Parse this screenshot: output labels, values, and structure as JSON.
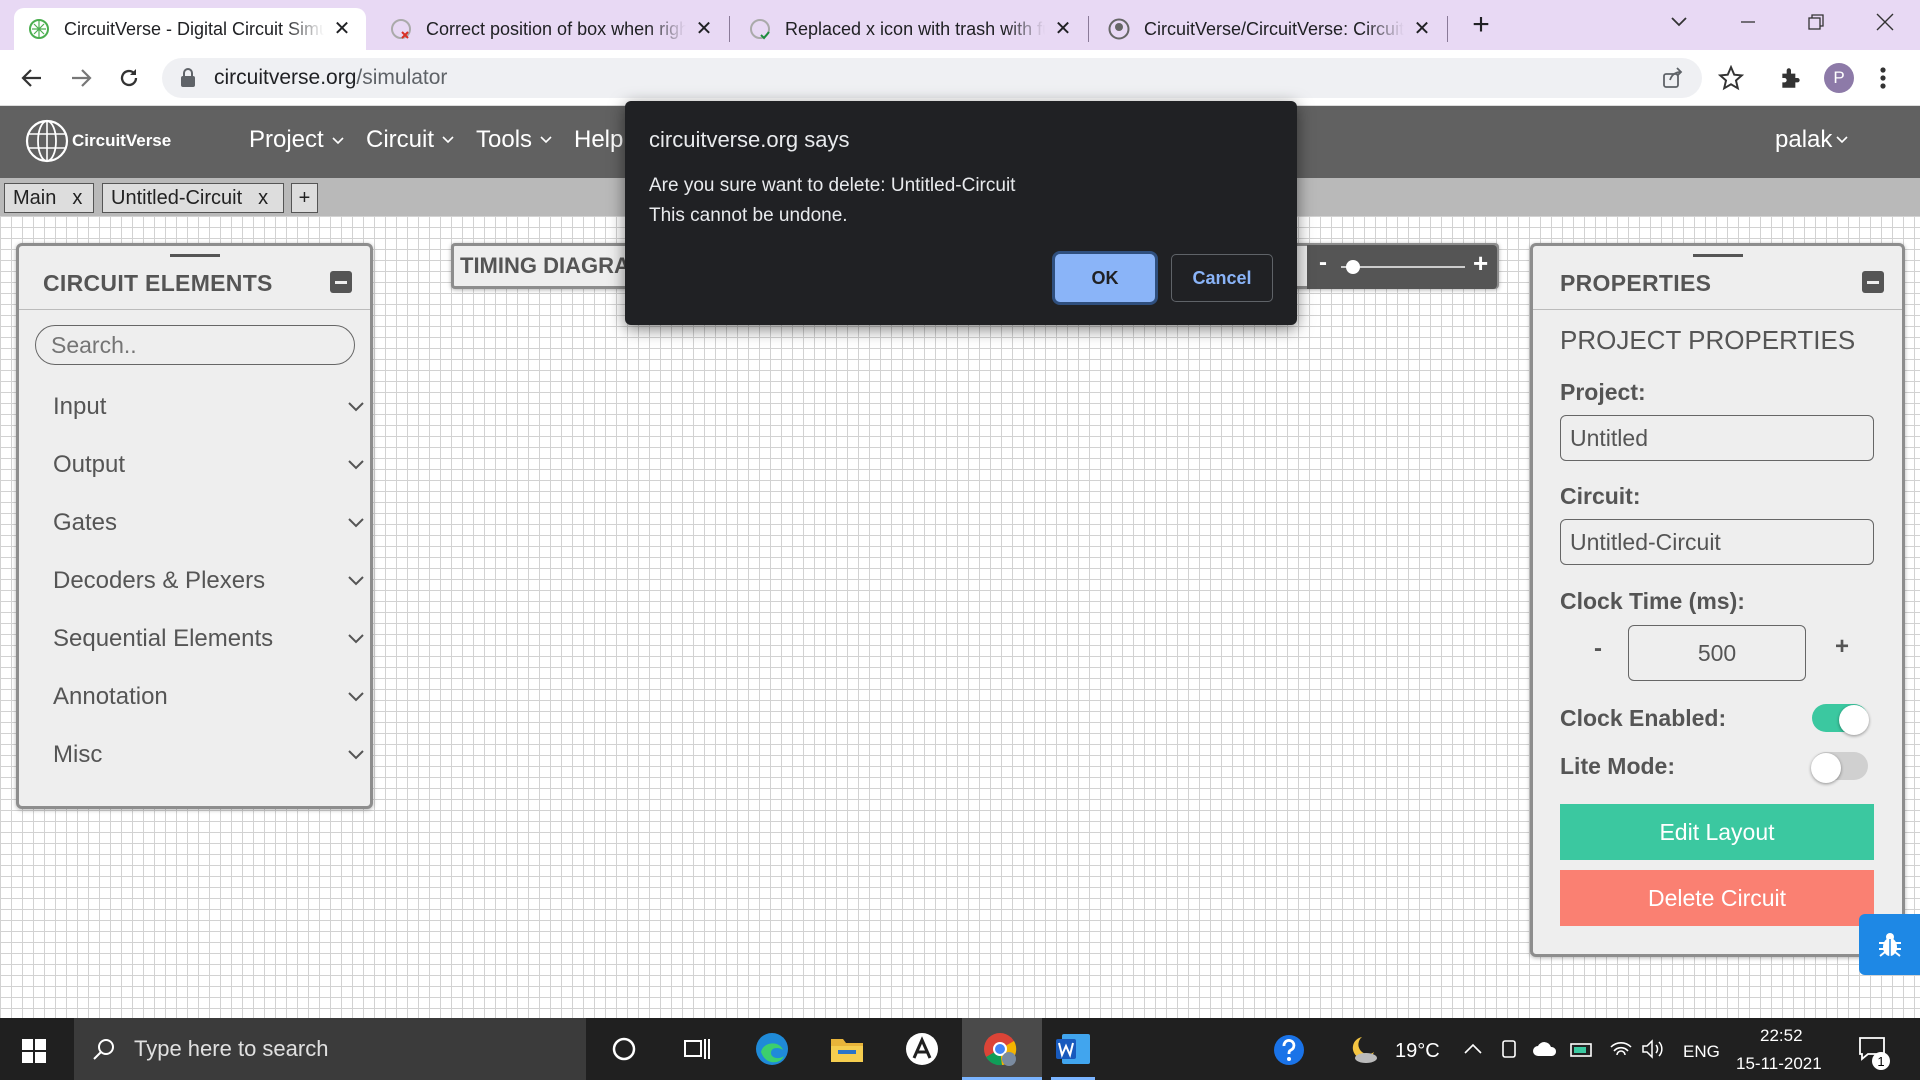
{
  "browser": {
    "tabs": [
      {
        "title": "CircuitVerse - Digital Circuit Simulator online",
        "active": true
      },
      {
        "title": "Correct position of box when right clicked"
      },
      {
        "title": "Replaced x icon with trash with functionality"
      },
      {
        "title": "CircuitVerse/CircuitVerse: CircuitVerse"
      }
    ],
    "close_glyph": "✕",
    "new_tab_glyph": "+",
    "url_host": "circuitverse.org",
    "url_path": "/simulator",
    "profile_initial": "P"
  },
  "nav": {
    "logo_text": "CircuitVerse",
    "menus": [
      "Project",
      "Circuit",
      "Tools",
      "Help"
    ],
    "user": "palak"
  },
  "circuit_tabs": [
    {
      "label": "Main",
      "close": "x"
    },
    {
      "label": "Untitled-Circuit",
      "close": "x"
    }
  ],
  "add_tab": "+",
  "timing": {
    "label": "TIMING DIAGRAM",
    "minus": "-",
    "plus": "+",
    "slider_level": 0.1
  },
  "elements_panel": {
    "title": "CIRCUIT ELEMENTS",
    "search_placeholder": "Search..",
    "groups": [
      "Input",
      "Output",
      "Gates",
      "Decoders & Plexers",
      "Sequential Elements",
      "Annotation",
      "Misc"
    ]
  },
  "properties": {
    "title": "PROPERTIES",
    "subtitle": "PROJECT PROPERTIES",
    "project_label": "Project:",
    "project_value": "Untitled",
    "circuit_label": "Circuit:",
    "circuit_value": "Untitled-Circuit",
    "clock_label": "Clock Time (ms):",
    "clock_value": "500",
    "clock_minus": "-",
    "clock_plus": "+",
    "clock_enabled_label": "Clock Enabled:",
    "clock_enabled": true,
    "lite_label": "Lite Mode:",
    "lite_mode": false,
    "edit_layout": "Edit Layout",
    "delete_circuit": "Delete Circuit"
  },
  "dialog": {
    "title": "circuitverse.org says",
    "line1": "Are you sure want to delete: Untitled-Circuit",
    "line2": "This cannot be undone.",
    "ok": "OK",
    "cancel": "Cancel"
  },
  "taskbar": {
    "search_placeholder": "Type here to search",
    "temperature": "19°C",
    "language": "ENG",
    "time": "22:52",
    "date": "15-11-2021",
    "notification_count": "1"
  },
  "colors": {
    "teal": "#3bc8a0",
    "salmon": "#fa8072",
    "nav": "#616161",
    "dialog_bg": "#202124",
    "ok_blue": "#8ab4f8",
    "tabstrip": "#e8d9f4"
  }
}
